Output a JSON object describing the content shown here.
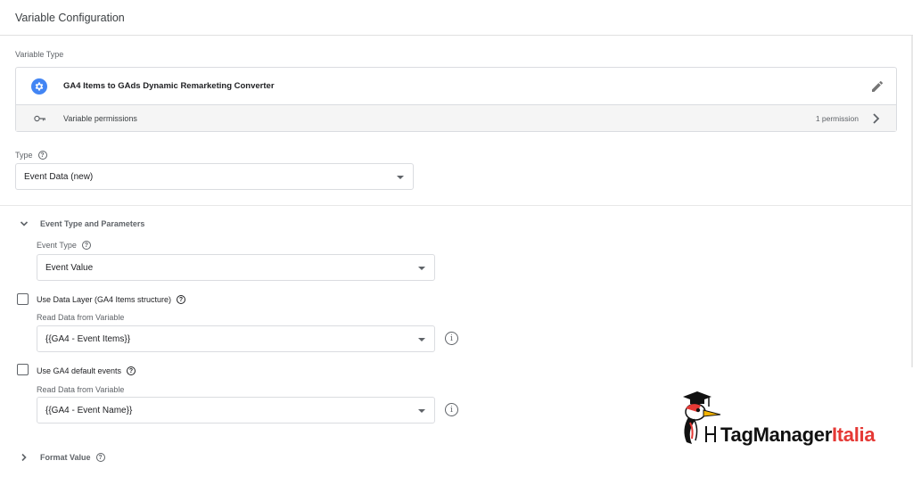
{
  "header": {
    "title": "Variable Configuration"
  },
  "variable_type": {
    "section_label": "Variable Type",
    "name": "GA4 Items to GAds Dynamic Remarketing Converter",
    "permissions_label": "Variable permissions",
    "permissions_count": "1 permission"
  },
  "type_field": {
    "label": "Type",
    "value": "Event Data (new)"
  },
  "event_section": {
    "title": "Event Type and Parameters",
    "event_type": {
      "label": "Event Type",
      "value": "Event Value"
    },
    "use_data_layer": {
      "label": "Use Data Layer (GA4 Items structure)",
      "checked": false
    },
    "read_var_1": {
      "label": "Read Data from Variable",
      "value": "{{GA4 - Event Items}}"
    },
    "use_ga4_default": {
      "label": "Use GA4 default events",
      "checked": false
    },
    "read_var_2": {
      "label": "Read Data from Variable",
      "value": "{{GA4 - Event Name}}"
    }
  },
  "format_section": {
    "title": "Format Value"
  },
  "logo": {
    "part1": "TagManager",
    "part2": "Italia"
  },
  "colors": {
    "accent_blue": "#4285f4",
    "brand_red": "#e53935"
  }
}
